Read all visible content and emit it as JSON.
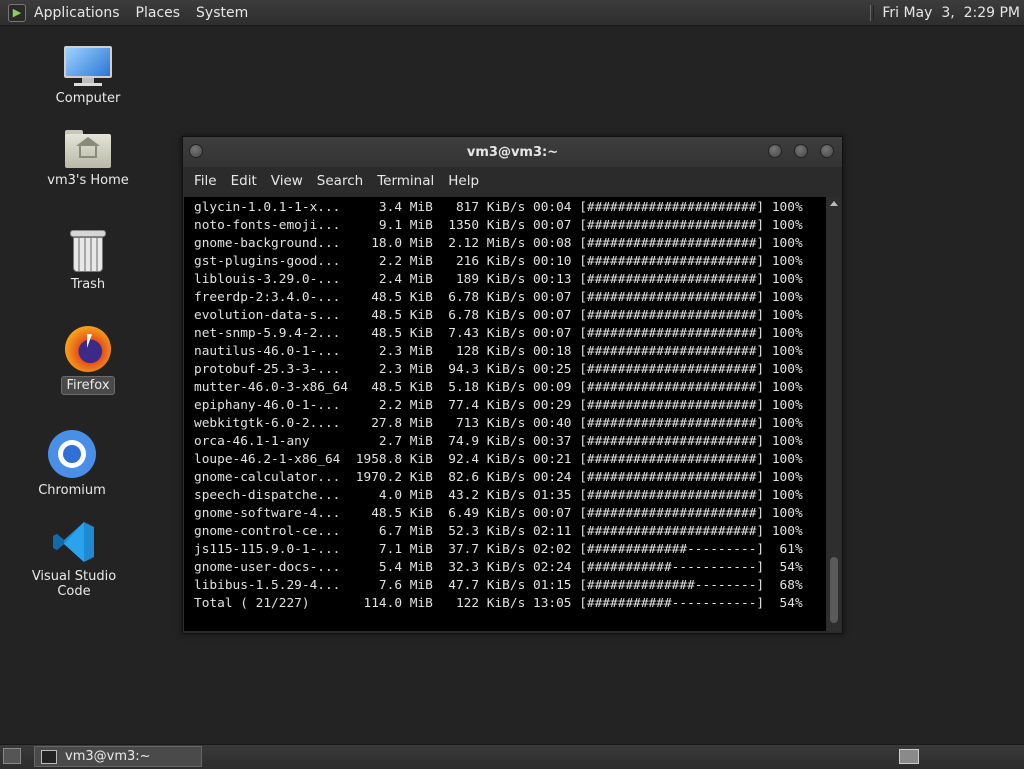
{
  "top_panel": {
    "menus": [
      "Applications",
      "Places",
      "System"
    ],
    "clock": "Fri May  3,  2:29 PM"
  },
  "desktop_icons": [
    {
      "label": "Computer",
      "icon": "computer-icon"
    },
    {
      "label": "vm3's Home",
      "icon": "home-folder-icon"
    },
    {
      "label": "Trash",
      "icon": "trash-icon"
    },
    {
      "label": "Firefox",
      "icon": "firefox-icon"
    },
    {
      "label": "Chromium",
      "icon": "chromium-icon"
    },
    {
      "label": "Visual Studio Code",
      "icon": "vscode-icon"
    }
  ],
  "terminal": {
    "title": "vm3@vm3:~",
    "menu": [
      "File",
      "Edit",
      "View",
      "Search",
      "Terminal",
      "Help"
    ],
    "lines": [
      "glycin-1.0.1-1-x...     3.4 MiB   817 KiB/s 00:04 [######################] 100%",
      "noto-fonts-emoji...     9.1 MiB  1350 KiB/s 00:07 [######################] 100%",
      "gnome-background...    18.0 MiB  2.12 MiB/s 00:08 [######################] 100%",
      "gst-plugins-good...     2.2 MiB   216 KiB/s 00:10 [######################] 100%",
      "liblouis-3.29.0-...     2.4 MiB   189 KiB/s 00:13 [######################] 100%",
      "freerdp-2:3.4.0-...    48.5 KiB  6.78 KiB/s 00:07 [######################] 100%",
      "evolution-data-s...    48.5 KiB  6.78 KiB/s 00:07 [######################] 100%",
      "net-snmp-5.9.4-2...    48.5 KiB  7.43 KiB/s 00:07 [######################] 100%",
      "nautilus-46.0-1-...     2.3 MiB   128 KiB/s 00:18 [######################] 100%",
      "protobuf-25.3-3-...     2.3 MiB  94.3 KiB/s 00:25 [######################] 100%",
      "mutter-46.0-3-x86_64   48.5 KiB  5.18 KiB/s 00:09 [######################] 100%",
      "epiphany-46.0-1-...     2.2 MiB  77.4 KiB/s 00:29 [######################] 100%",
      "webkitgtk-6.0-2....    27.8 MiB   713 KiB/s 00:40 [######################] 100%",
      "orca-46.1-1-any         2.7 MiB  74.9 KiB/s 00:37 [######################] 100%",
      "loupe-46.2-1-x86_64  1958.8 KiB  92.4 KiB/s 00:21 [######################] 100%",
      "gnome-calculator...  1970.2 KiB  82.6 KiB/s 00:24 [######################] 100%",
      "speech-dispatche...     4.0 MiB  43.2 KiB/s 01:35 [######################] 100%",
      "gnome-software-4...    48.5 KiB  6.49 KiB/s 00:07 [######################] 100%",
      "gnome-control-ce...     6.7 MiB  52.3 KiB/s 02:11 [######################] 100%",
      "js115-115.9.0-1-...     7.1 MiB  37.7 KiB/s 02:02 [#############---------]  61%",
      "gnome-user-docs-...     5.4 MiB  32.3 KiB/s 02:24 [###########-----------]  54%",
      "libibus-1.5.29-4...     7.6 MiB  47.7 KiB/s 01:15 [##############--------]  68%",
      "Total ( 21/227)       114.0 MiB   122 KiB/s 13:05 [###########-----------]  54%"
    ]
  },
  "taskbar": {
    "task_label": "vm3@vm3:~"
  },
  "colors": {
    "desktop_bg": "#232323",
    "panel_bg": "#333333",
    "terminal_bg": "#000000",
    "terminal_fg": "#e2e2e2"
  }
}
